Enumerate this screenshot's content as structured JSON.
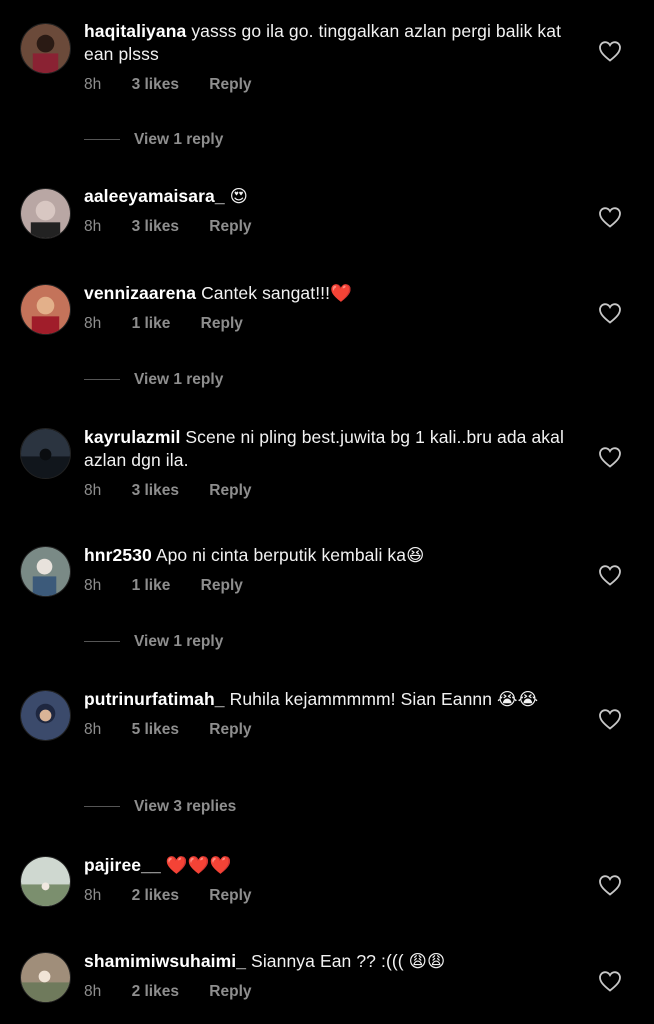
{
  "comments": [
    {
      "username": "haqitaliyana",
      "text": "yasss go ila go. tinggalkan azlan pergi balik kat ean plsss",
      "time": "8h",
      "likes": "3 likes",
      "reply_label": "Reply",
      "view_replies": "View 1 reply",
      "avatar_color": "#6b4a3a"
    },
    {
      "username": "aaleeyamaisara_",
      "text": "😍",
      "time": "8h",
      "likes": "3 likes",
      "reply_label": "Reply",
      "avatar_color": "#b9a7a4"
    },
    {
      "username": "vennizaarena",
      "text": "Cantek sangat!!!❤️",
      "time": "8h",
      "likes": "1 like",
      "reply_label": "Reply",
      "view_replies": "View 1 reply",
      "avatar_color": "#c4735a"
    },
    {
      "username": "kayrulazmil",
      "text": "Scene ni pling best.juwita bg 1 kali..bru ada akal azlan dgn ila.",
      "time": "8h",
      "likes": "3 likes",
      "reply_label": "Reply",
      "avatar_color": "#2b3440"
    },
    {
      "username": "hnr2530",
      "text": "Apo ni cinta berputik kembali ka😆",
      "time": "8h",
      "likes": "1 like",
      "reply_label": "Reply",
      "view_replies": "View 1 reply",
      "avatar_color": "#7a8a86"
    },
    {
      "username": "putrinurfatimah_",
      "text": "Ruhila kejammmmm! Sian Eannn 😭😭",
      "time": "8h",
      "likes": "5 likes",
      "reply_label": "Reply",
      "view_replies": "View 3 replies",
      "avatar_color": "#3b4a6b"
    },
    {
      "username": "pajiree__",
      "text": "❤️❤️❤️",
      "time": "8h",
      "likes": "2 likes",
      "reply_label": "Reply",
      "avatar_color": "#8fa08c"
    },
    {
      "username": "shamimiwsuhaimi_",
      "text": "Siannya Ean ?? :((( 😩😩",
      "time": "8h",
      "likes": "2 likes",
      "reply_label": "Reply",
      "avatar_color": "#a08e7a"
    }
  ],
  "icons": {
    "like": "heart-outline-icon"
  },
  "colors": {
    "background": "#000000",
    "meta_text": "#8e8e8e",
    "primary_text": "#f5f5f5"
  }
}
